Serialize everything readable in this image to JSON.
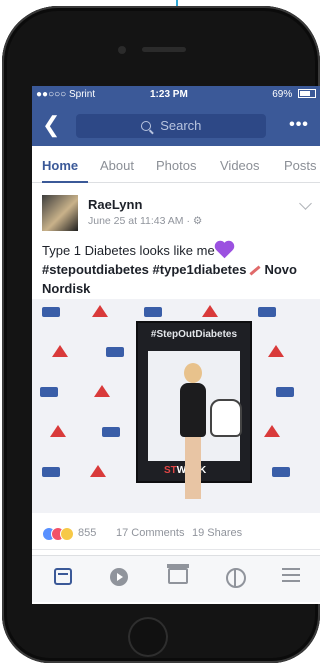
{
  "status_bar": {
    "carrier": "●●○○○ Sprint",
    "time": "1:23 PM",
    "battery": "69%"
  },
  "nav": {
    "back_icon": "chevron-left-icon",
    "search_placeholder": "Search",
    "more_label": "•••"
  },
  "tabs": [
    {
      "label": "Home",
      "active": true
    },
    {
      "label": "About",
      "active": false
    },
    {
      "label": "Photos",
      "active": false
    },
    {
      "label": "Videos",
      "active": false
    },
    {
      "label": "Posts",
      "active": false
    }
  ],
  "post": {
    "author": "RaeLynn",
    "timestamp": "June 25 at 11:43 AM · ⚙",
    "text_line1": "Type 1 Diabetes looks like me",
    "hashtags": "#stepoutdiabetes #type1diabetes",
    "text_tail": "Novo Nordisk",
    "photo": {
      "frame_caption": "#StepOutDiabetes",
      "walk_caption_prefix": "ST",
      "walk_caption_suffix": "WALK"
    },
    "reactions_count": "855",
    "comments": "17 Comments",
    "shares": "19 Shares"
  },
  "tabbar": [
    "news-feed-icon",
    "video-icon",
    "marketplace-icon",
    "globe-icon",
    "menu-icon"
  ]
}
